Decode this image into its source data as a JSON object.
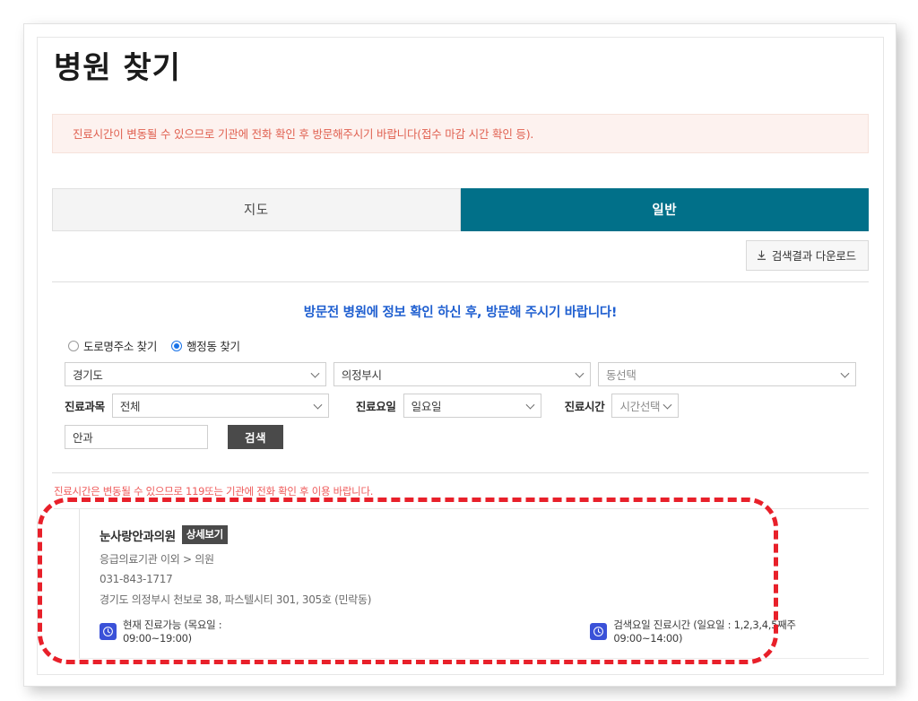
{
  "page": {
    "title": "병원 찾기",
    "notice_banner": "진료시간이 변동될 수 있으므로 기관에 전화 확인 후 방문해주시기 바랍니다(접수 마감 시간 확인 등).",
    "caution_line": "진료시간은 변동될 수 있으므로 119또는 기관에 전화 확인 후 이용 바랍니다."
  },
  "tabs": [
    {
      "label": "지도",
      "active": false,
      "name": "tab-map"
    },
    {
      "label": "일반",
      "active": true,
      "name": "tab-general"
    }
  ],
  "toolbar": {
    "download_label": "검색결과 다운로드",
    "download_icon": "download-icon"
  },
  "search_panel": {
    "heading": "방문전 병원에 정보 확인 하신 후, 방문해 주시기 바랍니다!",
    "radios": [
      {
        "label": "도로명주소 찾기",
        "checked": false
      },
      {
        "label": "행정동 찾기",
        "checked": true
      }
    ],
    "region_select": {
      "value": "경기도"
    },
    "city_select": {
      "value": "의정부시"
    },
    "dong_select": {
      "value": "동선택",
      "is_placeholder": true
    },
    "subject_label": "진료과목",
    "subject_select": {
      "value": "전체"
    },
    "day_label": "진료요일",
    "day_select": {
      "value": "일요일"
    },
    "time_label": "진료시간",
    "time_select": {
      "value": "시간선택",
      "is_placeholder": true
    },
    "keyword_input": {
      "value": "안과",
      "placeholder": ""
    },
    "search_button": "검색"
  },
  "results": [
    {
      "name": "눈사랑안과의원",
      "detail_badge": "상세보기",
      "category": "응급의료기관 이외 > 의원",
      "phone": "031-843-1717",
      "address": "경기도 의정부시 천보로 38, 파스텔시티 301, 305호 (민락동)",
      "current_hours": "현재 진료가능 (목요일 : 09:00~19:00)",
      "search_day_hours": "검색요일 진료시간 (일요일 : 1,2,3,4,5째주 09:00~14:00)",
      "clock_icon": "clock-icon"
    }
  ],
  "colors": {
    "tab_active": "#017089",
    "heading_blue": "#1f5fd0",
    "notice_red": "#e06151",
    "caution_red": "#ef5b5b",
    "badge_dark": "#4a4a4a",
    "clock_blue": "#3a51d8",
    "annotation_red": "#e8202a"
  },
  "annotation": {
    "shape": "dashed-rounded-rectangle",
    "color": "#e8202a"
  }
}
